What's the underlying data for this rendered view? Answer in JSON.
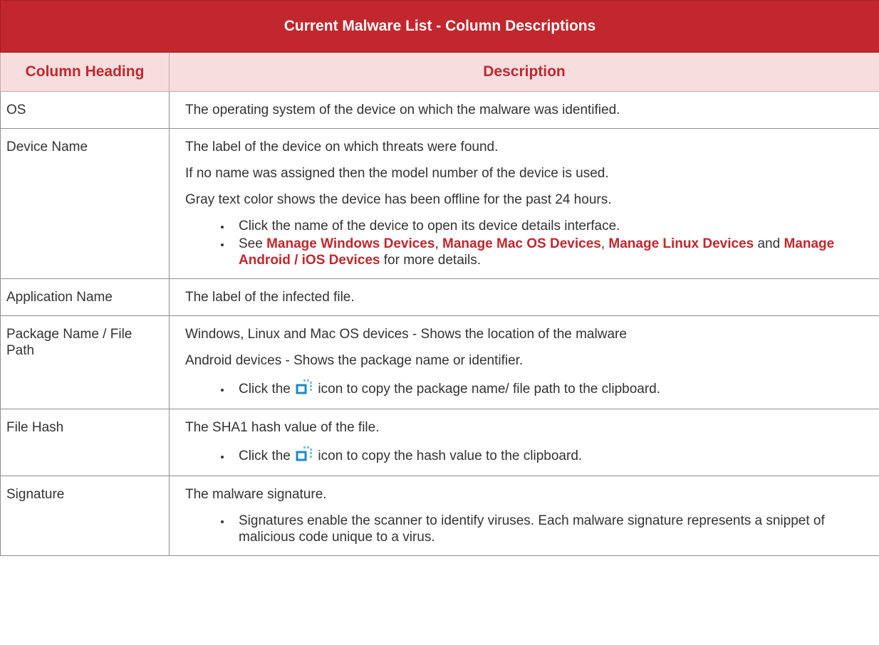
{
  "title": "Current Malware List - Column Descriptions",
  "headers": {
    "col1": "Column Heading",
    "col2": "Description"
  },
  "colors": {
    "accent": "#c1272d",
    "header_bg": "#f6dede",
    "text": "#333333"
  },
  "rows": [
    {
      "heading": "OS",
      "lines": [
        "The operating system of the device on which the malware was identified."
      ]
    },
    {
      "heading": "Device Name",
      "lines": [
        "The label of the device on which threats were found.",
        "If no name was assigned then the model number of the device is used.",
        "Gray text color shows the device has been offline for the past 24 hours."
      ],
      "bullet1": "Click the name of the device to open its device details interface.",
      "bullet2": {
        "pre": "See",
        "link1": "Manage Windows Devices",
        "sep1": ",",
        "link2": "Manage Mac OS Devices",
        "sep2": ",",
        "link3": "Manage Linux Devices",
        "mid": "and",
        "link4": "Manage Android / iOS Devices",
        "post": "for more details."
      }
    },
    {
      "heading": "Application Name",
      "lines": [
        "The label of the infected file."
      ]
    },
    {
      "heading": "Package Name / File Path",
      "lines": [
        "Windows, Linux and Mac OS devices - Shows the location of the malware",
        "Android devices - Shows the package name or identifier."
      ],
      "bullet_pre": "Click the",
      "bullet_post": "icon to copy the package name/ file path to the clipboard.",
      "icon": "copy-icon"
    },
    {
      "heading": "File Hash",
      "lines": [
        "The SHA1 hash value of the file."
      ],
      "bullet_pre": "Click the",
      "bullet_post": "icon to copy the hash value to the clipboard.",
      "icon": "copy-icon"
    },
    {
      "heading": "Signature",
      "lines": [
        "The malware signature."
      ],
      "bullet": "Signatures enable the scanner to identify viruses. Each malware signature represents a snippet of malicious code unique to a virus."
    }
  ]
}
